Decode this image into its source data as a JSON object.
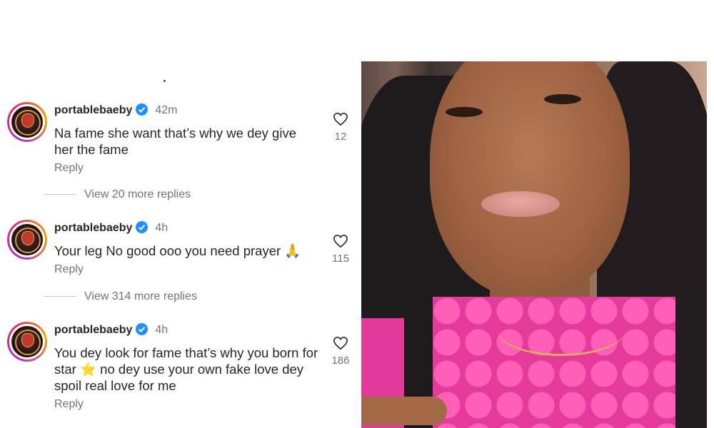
{
  "comments": [
    {
      "username": "portablebaeby",
      "time": "42m",
      "text": "Na fame she want that’s why we dey give her the fame",
      "reply_label": "Reply",
      "likes": "12",
      "view_more": "View 20 more replies"
    },
    {
      "username": "portablebaeby",
      "time": "4h",
      "text": "Your leg No good ooo you need prayer 🙏",
      "reply_label": "Reply",
      "likes": "115",
      "view_more": "View 314 more replies"
    },
    {
      "username": "portablebaeby",
      "time": "4h",
      "text": "You dey look for fame that’s why you born for star ⭐ no dey use your own fake love dey spoil real love for me",
      "reply_label": "Reply",
      "likes": "186"
    }
  ],
  "icons": {
    "verified": "verified-badge-icon",
    "like": "heart-icon"
  },
  "colors": {
    "verified_blue": "#1e90ff",
    "muted_text": "#737373",
    "avatar_ring": [
      "#b32dd1",
      "#e1306c",
      "#f7a600"
    ]
  }
}
